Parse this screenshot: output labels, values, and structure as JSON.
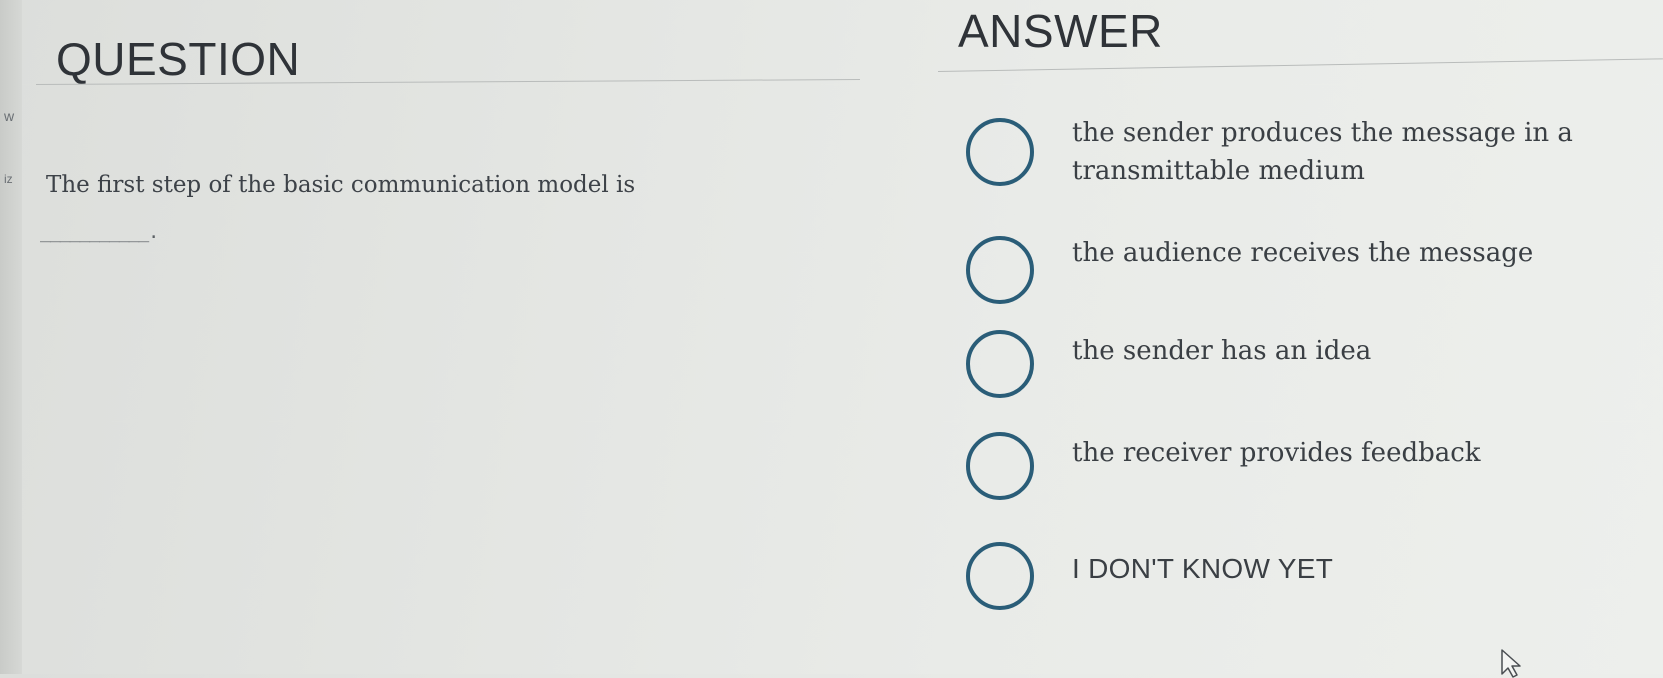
{
  "edge_fragments": {
    "top": "w",
    "bottom": "iz"
  },
  "question": {
    "heading": "QUESTION",
    "text": "The first step of the basic communication model is",
    "blank": "___________."
  },
  "answer": {
    "heading": "ANSWER",
    "options": [
      {
        "label": "the sender produces the message in a transmittable medium",
        "selected": false
      },
      {
        "label": "the audience receives the message",
        "selected": false
      },
      {
        "label": "the sender has an idea",
        "selected": false
      },
      {
        "label": "the receiver provides feedback",
        "selected": false
      },
      {
        "label": "I DON'T KNOW YET",
        "selected": false
      }
    ]
  },
  "colors": {
    "radio_border": "#2a5d78",
    "background": "#e6e8e5",
    "text": "#3a3f44"
  },
  "icons": {
    "cursor": "mouse-pointer-icon"
  }
}
